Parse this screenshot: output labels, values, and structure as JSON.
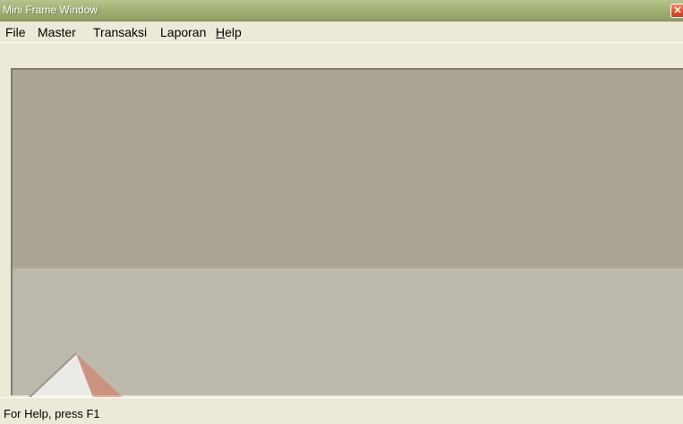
{
  "window": {
    "title": "Mini Frame Window"
  },
  "titlebar": {
    "close_icon": "close-icon"
  },
  "menubar": {
    "items": [
      {
        "label": "File"
      },
      {
        "label": "Master"
      },
      {
        "label": "Transaksi"
      },
      {
        "label": "Laporan"
      },
      {
        "label": "Help"
      }
    ]
  },
  "statusbar": {
    "text": "For Help, press F1"
  }
}
